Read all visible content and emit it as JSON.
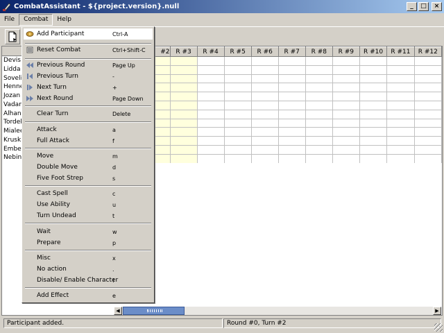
{
  "window": {
    "title": "CombatAssistant - ${project.version}.null"
  },
  "menubar": {
    "items": [
      "File",
      "Combat",
      "Help"
    ]
  },
  "table": {
    "names": [
      "Devis [",
      "Lidda [",
      "Sovelis",
      "Hennet",
      "Jozan [",
      "Vadani",
      "Alhand",
      "Tordek",
      "Mialee",
      "Krusk [",
      "Ember",
      "Nebin ["
    ],
    "headers": [
      "#2",
      "R #3",
      "R #4",
      "R #5",
      "R #6",
      "R #7",
      "R #8",
      "R #9",
      "R #10",
      "R #11",
      "R #12"
    ]
  },
  "combat_menu": {
    "items": [
      {
        "label": "Add Participant",
        "accel": "Ctrl-A",
        "icon": "add-participant-icon"
      },
      {
        "label": "Reset Combat",
        "accel": "Ctrl+Shift-C",
        "icon": "reset-icon"
      },
      {
        "label": "Previous Round",
        "accel": "Page Up",
        "icon": "previous-round-icon"
      },
      {
        "label": "Previous Turn",
        "accel": "-",
        "icon": "previous-turn-icon"
      },
      {
        "label": "Next Turn",
        "accel": "+",
        "icon": "next-turn-icon"
      },
      {
        "label": "Next Round",
        "accel": "Page Down",
        "icon": "next-round-icon"
      },
      {
        "label": "Clear Turn",
        "accel": "Delete"
      },
      {
        "label": "Attack",
        "accel": "a"
      },
      {
        "label": "Full Attack",
        "accel": "f"
      },
      {
        "label": "Move",
        "accel": "m"
      },
      {
        "label": "Double Move",
        "accel": "d"
      },
      {
        "label": "Five Foot Strep",
        "accel": "s"
      },
      {
        "label": "Cast Spell",
        "accel": "c"
      },
      {
        "label": "Use Ability",
        "accel": "u"
      },
      {
        "label": "Turn Undead",
        "accel": "t"
      },
      {
        "label": "Wait",
        "accel": "w"
      },
      {
        "label": "Prepare",
        "accel": "p"
      },
      {
        "label": "Misc",
        "accel": "x"
      },
      {
        "label": "No action",
        "accel": "."
      },
      {
        "label": "Disable/ Enable Character",
        "accel": "!"
      },
      {
        "label": "Add Effect",
        "accel": "e"
      }
    ]
  },
  "status": {
    "left": "Participant added.",
    "right": "Round #0, Turn #2"
  },
  "colors": {
    "titlebar_start": "#0a246a",
    "titlebar_end": "#a6caf0",
    "current_column": "#ffffdd",
    "scroll_thumb": "#6b8dc8"
  }
}
